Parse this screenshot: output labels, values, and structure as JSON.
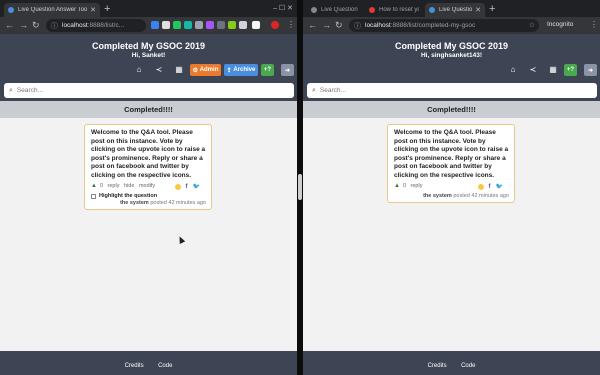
{
  "left": {
    "tabs": [
      {
        "title": "Live Question Answer Tool",
        "active": true,
        "favicon_color": "#4a8ede"
      }
    ],
    "url": {
      "host": "localhost",
      "path": ":8888/list/c..."
    },
    "page_title": "Completed My GSOC 2019",
    "greeting": "Hi, Sanket!",
    "buttons": {
      "admin": "Admin",
      "archive": "Archive",
      "new": "+?"
    },
    "search_placeholder": "Search...",
    "section_title": "Completed!!!!",
    "card": {
      "text": "Welcome to the Q&A tool. Please post on this instance. Vote by clicking on the upvote icon to raise a post's prominence. Reply or share a post on facebook and twitter by clicking on the respective icons.",
      "votes": "0",
      "reply": "reply",
      "hide": "hide",
      "modify": "modify",
      "highlight": "Highlight the question",
      "author": "the system",
      "posted": "posted 42 minutes ago"
    },
    "footer": {
      "credits": "Credits",
      "code": "Code"
    }
  },
  "right": {
    "tabs": [
      {
        "title": "Live Question Answer Too",
        "active": false
      },
      {
        "title": "How to reset your passw...",
        "active": false
      },
      {
        "title": "Live Question Answer Too",
        "active": true
      }
    ],
    "url": {
      "host": "localhost",
      "path": ":8888/list/completed-my-gsoc"
    },
    "incognito": "Incognito",
    "page_title": "Completed My GSOC 2019",
    "greeting": "Hi, singhsanket143!",
    "buttons": {
      "new": "+?"
    },
    "search_placeholder": "Search...",
    "section_title": "Completed!!!!",
    "card": {
      "text": "Welcome to the Q&A tool. Please post on this instance. Vote by clicking on the upvote icon to raise a post's prominence. Reply or share a post on facebook and twitter by clicking on the respective icons.",
      "votes": "0",
      "reply": "reply",
      "author": "the system",
      "posted": "posted 42 minutes ago"
    },
    "footer": {
      "credits": "Credits",
      "code": "Code"
    }
  },
  "colors": {
    "header_bg": "#3d4454",
    "admin": "#ea7a2e",
    "archive": "#4a8ede",
    "new_question": "#4aa84e",
    "card_border": "#e9c98a"
  },
  "icons": [
    "home-icon",
    "share-icon",
    "qrcode-icon",
    "gear-icon",
    "upload-icon",
    "logout-icon",
    "search-icon",
    "upvote-icon",
    "emoji-icon",
    "facebook-icon",
    "twitter-icon"
  ]
}
